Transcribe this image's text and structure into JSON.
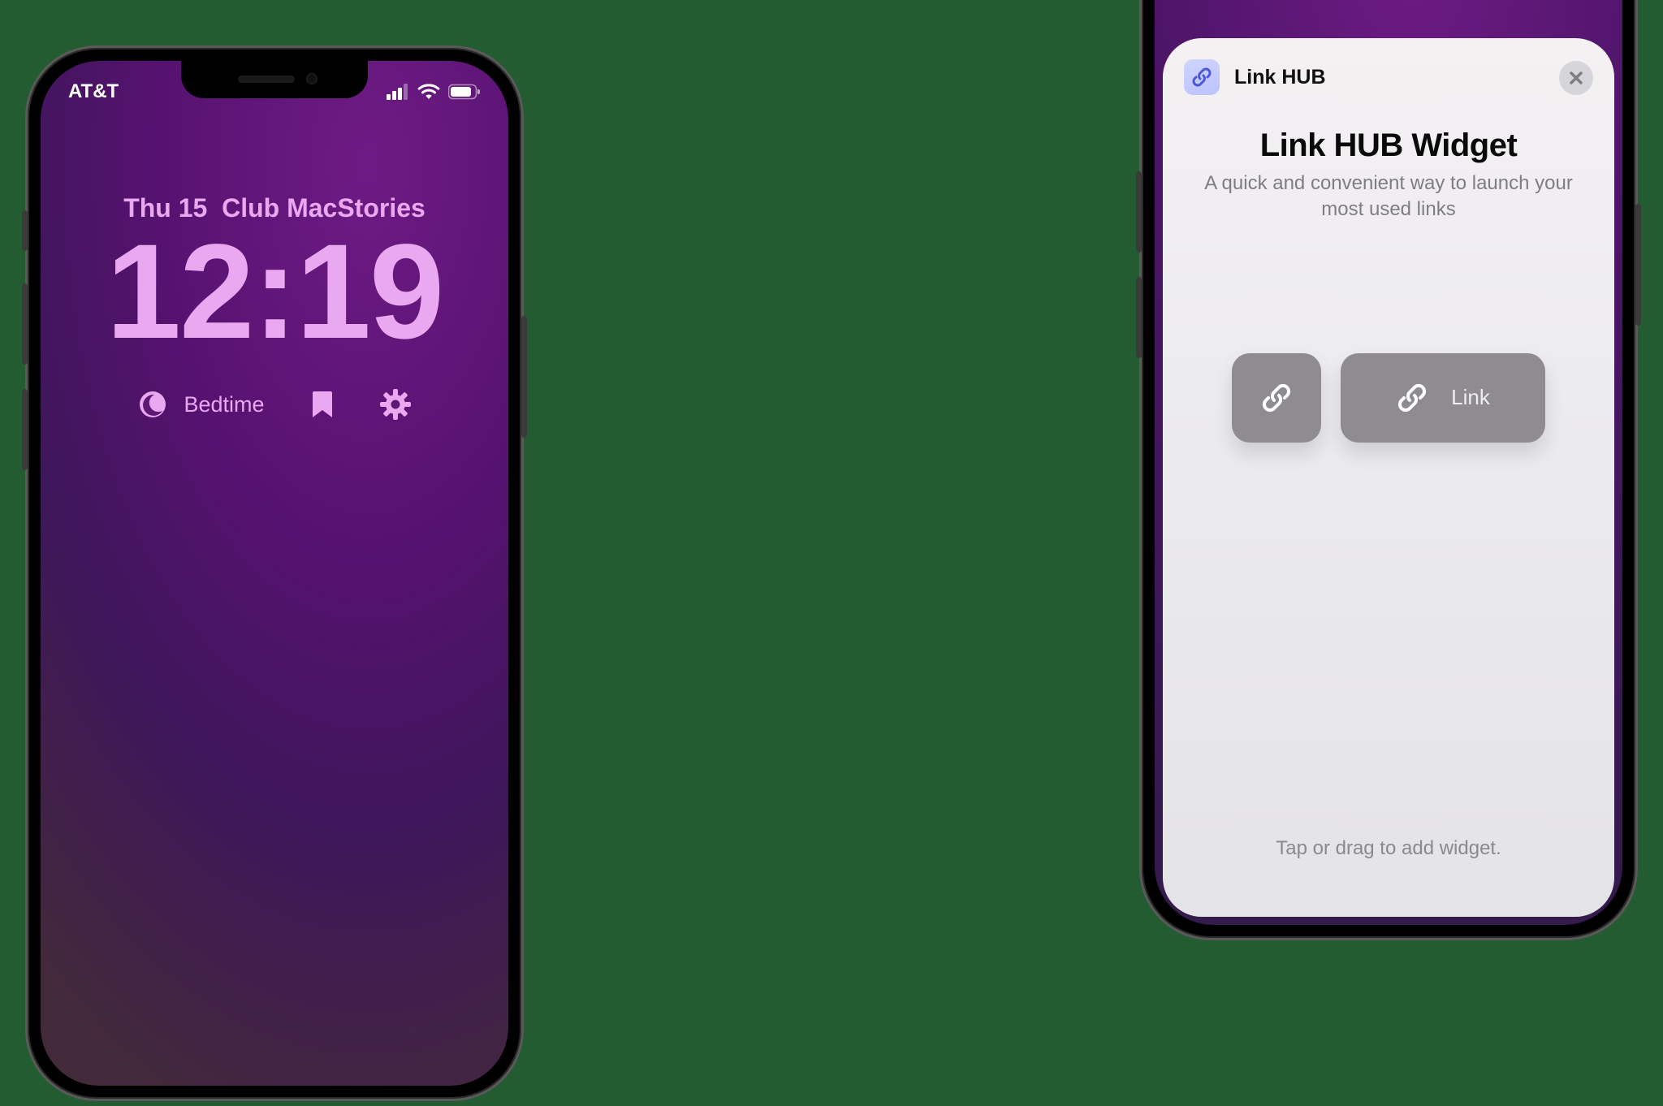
{
  "left": {
    "carrier": "AT&T",
    "date": "Thu 15",
    "header": "Club MacStories",
    "time": "12:19",
    "widgets": {
      "bedtime_label": "Bedtime"
    }
  },
  "right": {
    "sheet": {
      "app_name": "Link HUB",
      "title": "Link HUB Widget",
      "description": "A quick and convenient way to launch your most used links",
      "widget_label": "Link",
      "footer": "Tap or drag to add widget."
    }
  }
}
